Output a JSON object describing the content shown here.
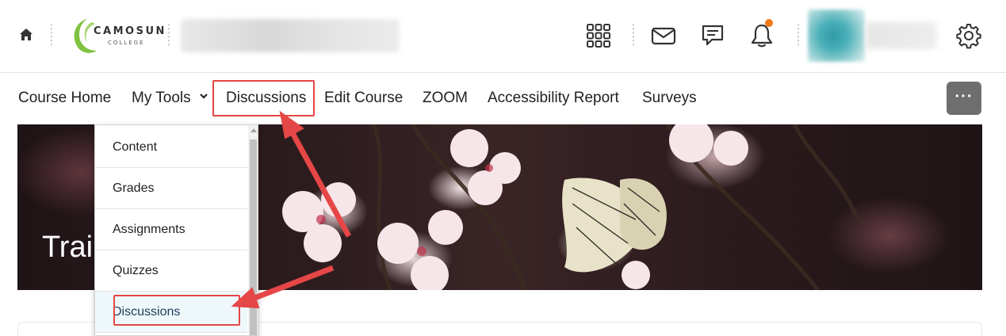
{
  "header": {
    "logo": {
      "name": "CAMOSUN",
      "sub": "COLLEGE"
    },
    "icons": [
      "home-icon",
      "waffle-icon",
      "mail-icon",
      "chat-icon",
      "bell-icon",
      "gear-icon"
    ],
    "notification_color": "#f07a1a"
  },
  "nav": {
    "items": [
      "Course Home",
      "My Tools",
      "Discussions",
      "Edit Course",
      "ZOOM",
      "Accessibility Report",
      "Surveys"
    ],
    "more_label": "···"
  },
  "banner": {
    "title": "Trai"
  },
  "dropdown": {
    "items": [
      "Content",
      "Grades",
      "Assignments",
      "Quizzes",
      "Discussions"
    ],
    "selected": "Discussions"
  },
  "annotations": {
    "color": "#e54646"
  }
}
